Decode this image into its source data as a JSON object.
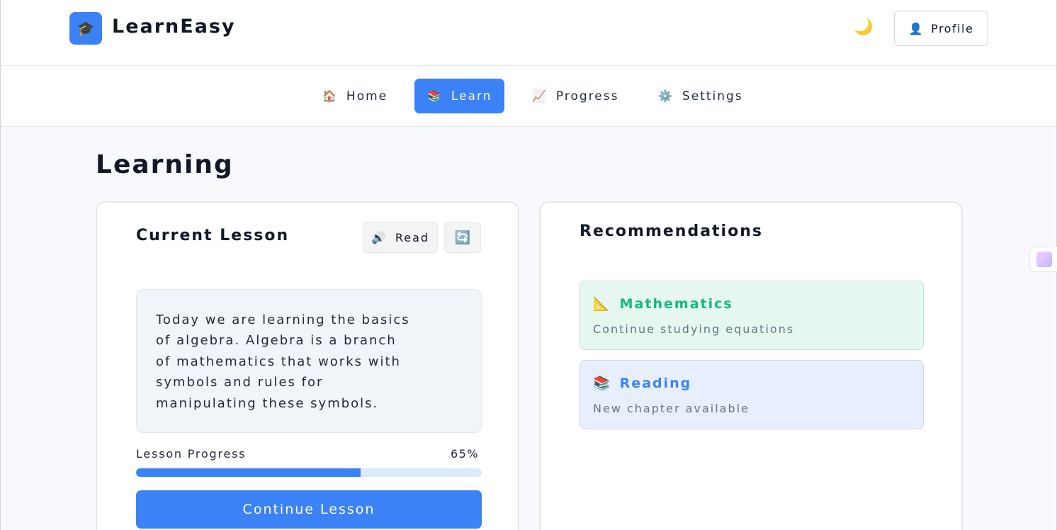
{
  "header": {
    "logo_icon": "🎓",
    "brand": "LearnEasy",
    "theme_icon": "🌙",
    "profile": {
      "icon": "👤",
      "label": "Profile"
    }
  },
  "nav": {
    "items": [
      {
        "icon": "🏠",
        "label": "Home",
        "active": false
      },
      {
        "icon": "📚",
        "label": "Learn",
        "active": true
      },
      {
        "icon": "📈",
        "label": "Progress",
        "active": false
      },
      {
        "icon": "⚙️",
        "label": "Settings",
        "active": false
      }
    ]
  },
  "page": {
    "title": "Learning"
  },
  "lesson": {
    "title": "Current Lesson",
    "read_icon": "🔊",
    "read_label": "Read",
    "refresh_icon": "🔄",
    "text": "Today we are learning the basics of algebra. Algebra is a branch of mathematics that works with symbols and rules for manipulating these symbols.",
    "progress_label": "Lesson Progress",
    "progress_value": "65%",
    "progress_fraction": 0.65,
    "continue_label": "Continue Lesson"
  },
  "recommendations": {
    "title": "Recommendations",
    "items": [
      {
        "icon": "📐",
        "title": "Mathematics",
        "subtitle": "Continue studying equations"
      },
      {
        "icon": "📚",
        "title": "Reading",
        "subtitle": "New chapter available"
      }
    ]
  },
  "colors": {
    "accent": "#3b82f6",
    "math_green": "#10b981"
  }
}
